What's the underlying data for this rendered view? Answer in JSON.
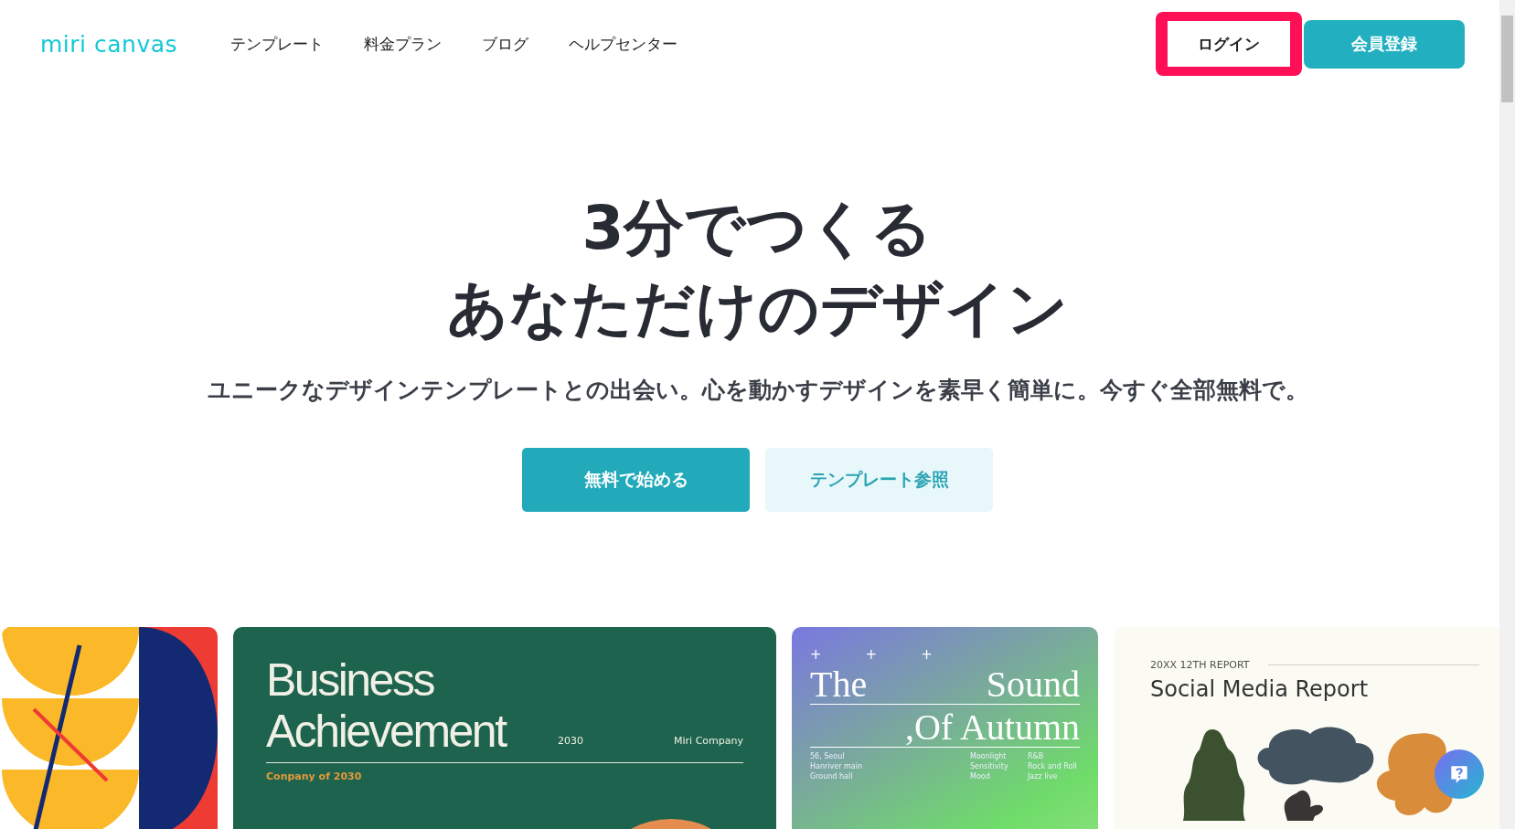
{
  "header": {
    "logo": "miri canvas",
    "nav": [
      {
        "label": "テンプレート"
      },
      {
        "label": "料金プラン"
      },
      {
        "label": "ブログ"
      },
      {
        "label": "ヘルプセンター"
      }
    ],
    "login_button": {
      "label": "ログイン",
      "highlighted": true
    },
    "signup_button": {
      "label": "会員登録"
    }
  },
  "hero": {
    "title_lines": [
      "3分でつくる",
      "あなただけのデザイン"
    ],
    "subtitle": "ユニークなデザインテンプレートとの出会い。心を動かすデザインを素早く簡単に。今すぐ全部無料で。",
    "primary_button": "無料で始める",
    "secondary_button": "テンプレート参照"
  },
  "templates": [
    {
      "kind": "abstract"
    },
    {
      "kind": "business",
      "title_lines": [
        "Business",
        "Achievement"
      ],
      "year": "2030",
      "company": "Miri Company",
      "tagline": "Conpany of 2030"
    },
    {
      "kind": "poster",
      "marks": [
        "+",
        "+",
        "+"
      ],
      "title_left": "The",
      "title_right": "Sound",
      "title_second": ",Of Autumn",
      "info_columns": [
        [
          "56, Seoul",
          "Hanriver main",
          "Ground hall"
        ],
        [
          "Moonlight",
          "Sensitivity",
          "Mood"
        ],
        [
          "R&B",
          "Rock and Roll",
          "Jazz live"
        ]
      ]
    },
    {
      "kind": "report",
      "eyebrow": "20XX 12TH REPORT",
      "title": "Social Media Report"
    }
  ]
}
